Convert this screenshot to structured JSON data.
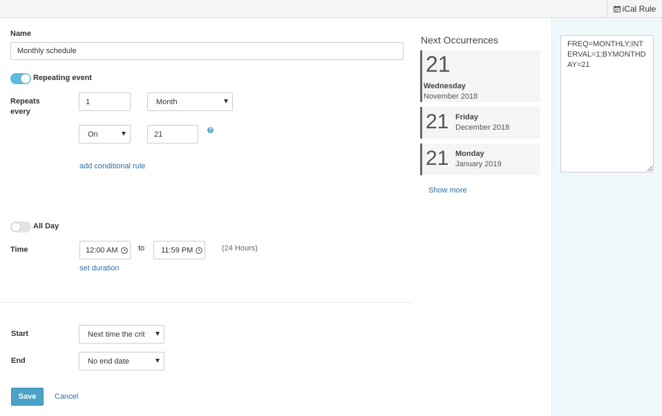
{
  "toolbar": {
    "ical_label": "iCal Rule"
  },
  "form": {
    "name_label": "Name",
    "name_value": "Monthly schedule",
    "repeating_label": "Repeating event",
    "repeats_label": "Repeats every",
    "interval_value": "1",
    "freq_value": "Month",
    "on_value": "On",
    "day_value": "21",
    "conditional_link": "add conditional rule",
    "allday_label": "All Day",
    "time_label": "Time",
    "time_start": "12:00 AM",
    "time_to": "to",
    "time_end": "11:59 PM",
    "hours_note": "(24 Hours)",
    "duration_link": "set duration",
    "start_label": "Start",
    "start_value": "Next time the crit",
    "end_label": "End",
    "end_value": "No end date",
    "save_label": "Save",
    "cancel_label": "Cancel"
  },
  "occurrences": {
    "title": "Next Occurrences",
    "items": [
      {
        "day": "21",
        "weekday": "Wednesday",
        "month": "November 2018"
      },
      {
        "day": "21",
        "weekday": "Friday",
        "month": "December 2018"
      },
      {
        "day": "21",
        "weekday": "Monday",
        "month": "January 2019"
      }
    ],
    "show_more": "Show more"
  },
  "ical": {
    "text": "FREQ=MONTHLY;INTERVAL=1;BYMONTHDAY=21"
  },
  "colors": {
    "accent": "#4ba2c6",
    "toggle_on": "#5bbce0",
    "link": "#2a6ea8",
    "panel_bg": "#f0f8fc"
  }
}
